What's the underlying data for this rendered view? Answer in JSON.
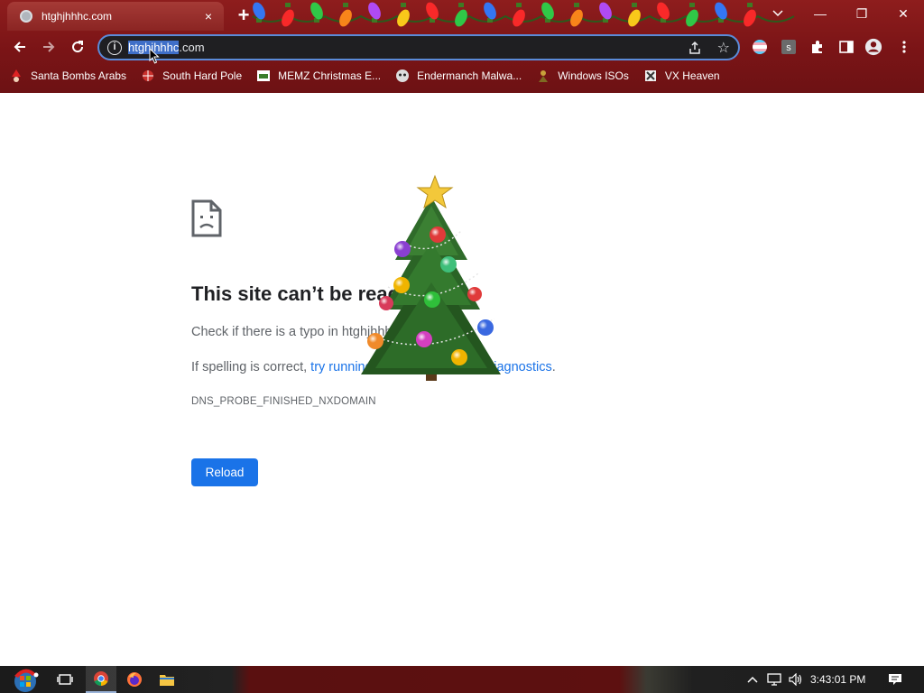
{
  "tab": {
    "title": "htghjhhhc.com",
    "close_icon": "×"
  },
  "window": {
    "new_tab": "+",
    "minimize": "—",
    "restore": "❐",
    "close": "✕"
  },
  "omnibox": {
    "url_selected": "htghjhhhc",
    "url_rest": ".com"
  },
  "bookmarks": [
    {
      "label": "Santa Bombs Arabs",
      "icon": "santa-icon"
    },
    {
      "label": "South Hard Pole",
      "icon": "snowflake-icon"
    },
    {
      "label": "MEMZ Christmas E...",
      "icon": "memz-icon"
    },
    {
      "label": "Endermanch Malwa...",
      "icon": "endermanch-icon"
    },
    {
      "label": "Windows ISOs",
      "icon": "windows-isos-icon"
    },
    {
      "label": "VX Heaven",
      "icon": "vx-heaven-icon"
    }
  ],
  "error_page": {
    "heading": "This site can’t be reached",
    "check_text": "Check if there is a typo in htghjhhhc.com.",
    "spell_prefix": "If spelling is correct, ",
    "spell_link": "try running Windows Network Diagnostics",
    "spell_suffix": ".",
    "error_code": "DNS_PROBE_FINISHED_NXDOMAIN",
    "reload_label": "Reload"
  },
  "taskbar": {
    "time": "3:43:01 PM"
  },
  "colors": {
    "chrome_bg": "#7a1416",
    "accent": "#1a73e8",
    "link": "#1a73e8",
    "text": "#202124",
    "muted": "#5f6368"
  }
}
